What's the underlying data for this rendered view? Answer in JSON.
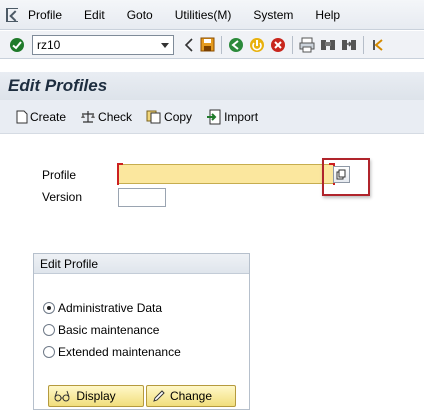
{
  "menu": {
    "items": [
      {
        "label": "Profile"
      },
      {
        "label": "Edit"
      },
      {
        "label": "Goto"
      },
      {
        "label": "Utilities(M)"
      },
      {
        "label": "System"
      },
      {
        "label": "Help"
      }
    ]
  },
  "toolbar": {
    "command_value": "rz10"
  },
  "page": {
    "title": "Edit Profiles"
  },
  "app_toolbar": {
    "create": "Create",
    "check": "Check",
    "copy": "Copy",
    "import": "Import"
  },
  "form": {
    "profile_label": "Profile",
    "profile_value": "",
    "version_label": "Version",
    "version_value": ""
  },
  "edit_profile_group": {
    "title": "Edit Profile",
    "options": [
      {
        "label": "Administrative Data",
        "selected": true
      },
      {
        "label": "Basic maintenance",
        "selected": false
      },
      {
        "label": "Extended maintenance",
        "selected": false
      }
    ],
    "display_button": "Display",
    "change_button": "Change"
  },
  "colors": {
    "required_field": "#fbe79e",
    "highlight": "#b0242b"
  }
}
